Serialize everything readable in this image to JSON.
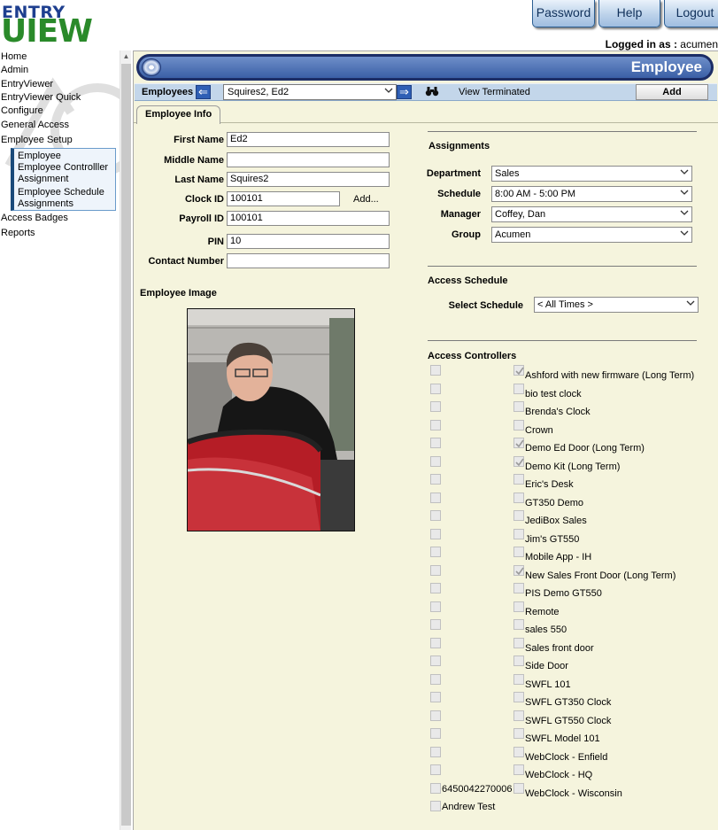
{
  "logo": {
    "line1": "ENTRY",
    "line2": "UIEW"
  },
  "top_buttons": {
    "password": "Password",
    "help": "Help",
    "logout": "Logout"
  },
  "logged_in": {
    "label": "Logged in as :",
    "user": "acumen"
  },
  "nav": {
    "items": [
      "Home",
      "Admin",
      "EntryViewer",
      "EntryViewer Quick",
      "Configure",
      "General Access",
      "Employee Setup"
    ],
    "sub_items": [
      "Employee",
      "Employee Controlller Assignment",
      "Employee Schedule Assignments"
    ],
    "after_items": [
      "Access Badges",
      "Reports"
    ]
  },
  "page_title": "Employee",
  "employee_bar": {
    "label": "Employees",
    "selected": "Squires2, Ed2",
    "view_terminated": "View Terminated",
    "add": "Add"
  },
  "tab": "Employee Info",
  "form": {
    "first_name": {
      "label": "First Name",
      "value": "Ed2"
    },
    "middle_name": {
      "label": "Middle Name",
      "value": ""
    },
    "last_name": {
      "label": "Last Name",
      "value": "Squires2"
    },
    "clock_id": {
      "label": "Clock ID",
      "value": "100101",
      "add": "Add..."
    },
    "payroll_id": {
      "label": "Payroll ID",
      "value": "100101"
    },
    "pin": {
      "label": "PIN",
      "value": "10"
    },
    "contact_number": {
      "label": "Contact Number",
      "value": ""
    },
    "employee_image": "Employee Image"
  },
  "assignments": {
    "title": "Assignments",
    "department": {
      "label": "Department",
      "value": "Sales"
    },
    "schedule": {
      "label": "Schedule",
      "value": "8:00 AM - 5:00 PM"
    },
    "manager": {
      "label": "Manager",
      "value": "Coffey, Dan"
    },
    "group": {
      "label": "Group",
      "value": "Acumen"
    }
  },
  "access_schedule": {
    "title": "Access Schedule",
    "select_label": "Select Schedule",
    "value": "< All Times >"
  },
  "access_controllers": {
    "title": "Access Controllers",
    "left_labels": [
      "",
      "",
      "",
      "",
      "",
      "",
      "",
      "",
      "",
      "",
      "",
      "",
      "",
      "",
      "",
      "",
      "",
      "",
      "",
      "",
      "",
      "",
      "",
      "6450042270006",
      "Andrew Test"
    ],
    "right": [
      {
        "label": "Ashford with new firmware (Long Term)",
        "checked": true
      },
      {
        "label": "bio test clock",
        "checked": false
      },
      {
        "label": "Brenda's Clock",
        "checked": false
      },
      {
        "label": "Crown",
        "checked": false
      },
      {
        "label": "Demo Ed Door (Long Term)",
        "checked": true
      },
      {
        "label": "Demo Kit (Long Term)",
        "checked": true
      },
      {
        "label": "Eric's Desk",
        "checked": false
      },
      {
        "label": "GT350 Demo",
        "checked": false
      },
      {
        "label": "JediBox Sales",
        "checked": false
      },
      {
        "label": "Jim's GT550",
        "checked": false
      },
      {
        "label": "Mobile App - IH",
        "checked": false
      },
      {
        "label": "New Sales Front Door (Long Term)",
        "checked": true
      },
      {
        "label": "PIS Demo GT550",
        "checked": false
      },
      {
        "label": "Remote",
        "checked": false
      },
      {
        "label": "sales 550",
        "checked": false
      },
      {
        "label": "Sales front door",
        "checked": false
      },
      {
        "label": "Side Door",
        "checked": false
      },
      {
        "label": "SWFL 101",
        "checked": false
      },
      {
        "label": "SWFL GT350 Clock",
        "checked": false
      },
      {
        "label": "SWFL GT550 Clock",
        "checked": false
      },
      {
        "label": "SWFL Model 101",
        "checked": false
      },
      {
        "label": "WebClock - Enfield",
        "checked": false
      },
      {
        "label": "WebClock - HQ",
        "checked": false
      },
      {
        "label": "WebClock - Wisconsin",
        "checked": false
      }
    ]
  },
  "colors": {
    "title_bar": "#3a5fa6",
    "panel": "#f5f4dd",
    "logo_blue": "#1e3f8f",
    "logo_green": "#2a8a2a"
  }
}
